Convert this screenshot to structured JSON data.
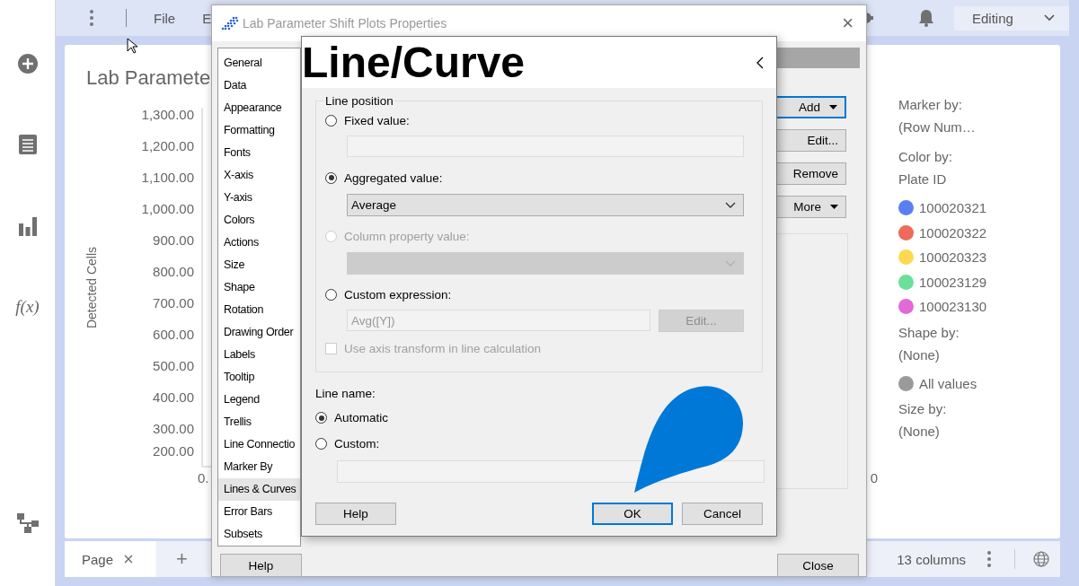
{
  "app": {
    "rail": {
      "function_label": "f(x)"
    },
    "menu": [
      "File",
      "E"
    ],
    "mode_dropdown": "Editing"
  },
  "page": {
    "title": "Lab Paramete",
    "plot": {
      "y_axis_title": "Detected Cells",
      "y_ticks": [
        "1,300.00",
        "1,200.00",
        "1,100.00",
        "1,000.00",
        "900.00",
        "800.00",
        "700.00",
        "600.00",
        "500.00",
        "400.00",
        "300.00",
        "200.00"
      ],
      "x_ticks": [
        "0.",
        "0"
      ]
    },
    "legend": [
      {
        "kind": "heading",
        "text": "Marker by:"
      },
      {
        "kind": "value",
        "text": "(Row Num…"
      },
      {
        "kind": "heading",
        "text": "Color by:"
      },
      {
        "kind": "value",
        "text": "Plate ID"
      },
      {
        "kind": "swatch",
        "text": "100020321",
        "color": "#5b7ff0"
      },
      {
        "kind": "swatch",
        "text": "100020322",
        "color": "#ef6a5a"
      },
      {
        "kind": "swatch",
        "text": "100020323",
        "color": "#fcd94e"
      },
      {
        "kind": "swatch",
        "text": "100023129",
        "color": "#6be09a"
      },
      {
        "kind": "swatch",
        "text": "100023130",
        "color": "#e469d8"
      },
      {
        "kind": "heading",
        "text": "Shape by:"
      },
      {
        "kind": "value",
        "text": "(None)"
      },
      {
        "kind": "swatch",
        "text": "All values",
        "color": "#9a9a9a"
      },
      {
        "kind": "heading",
        "text": "Size by:"
      },
      {
        "kind": "value",
        "text": "(None)"
      }
    ]
  },
  "status_bar": {
    "tabs": [
      {
        "label": "Page",
        "selected": true
      }
    ],
    "add_tab": "+",
    "column_count": "13 columns"
  },
  "properties_dialog": {
    "title": "Lab Parameter Shift Plots Properties",
    "close": "×",
    "categories": [
      {
        "label": "General",
        "selected": false
      },
      {
        "label": "Data",
        "selected": false
      },
      {
        "label": "Appearance",
        "selected": false
      },
      {
        "label": "Formatting",
        "selected": false
      },
      {
        "label": "Fonts",
        "selected": false
      },
      {
        "label": "X-axis",
        "selected": false
      },
      {
        "label": "Y-axis",
        "selected": false
      },
      {
        "label": "Colors",
        "selected": false
      },
      {
        "label": "Actions",
        "selected": false
      },
      {
        "label": "Size",
        "selected": false
      },
      {
        "label": "Shape",
        "selected": false
      },
      {
        "label": "Rotation",
        "selected": false
      },
      {
        "label": "Drawing Order",
        "selected": false
      },
      {
        "label": "Labels",
        "selected": false
      },
      {
        "label": "Tooltip",
        "selected": false
      },
      {
        "label": "Legend",
        "selected": false
      },
      {
        "label": "Trellis",
        "selected": false
      },
      {
        "label": "Line Connectio",
        "selected": false
      },
      {
        "label": "Marker By",
        "selected": false
      },
      {
        "label": "Lines & Curves",
        "selected": true
      },
      {
        "label": "Error Bars",
        "selected": false
      },
      {
        "label": "Subsets",
        "selected": false
      }
    ],
    "line_buttons": [
      {
        "label": "Add",
        "menu": true,
        "focused": true
      },
      {
        "label": "Edit...",
        "menu": false,
        "focused": false
      },
      {
        "label": "Remove",
        "menu": false,
        "focused": false
      },
      {
        "label": "More",
        "menu": true,
        "focused": false
      }
    ],
    "help": "Help",
    "close_button": "Close"
  },
  "line_dialog": {
    "caption": "Line/Curve",
    "position": {
      "title": "Line position",
      "options": [
        {
          "label": "Fixed value:",
          "selected": false,
          "disabled": false,
          "control": {
            "kind": "input",
            "disabled": true
          }
        },
        {
          "label": "Aggregated value:",
          "selected": true,
          "disabled": false,
          "control": {
            "kind": "select",
            "value": "Average",
            "disabled": false
          }
        },
        {
          "label": "Column property value:",
          "selected": false,
          "disabled": true,
          "control": {
            "kind": "select",
            "disabled": true
          }
        },
        {
          "label": "Custom expression:",
          "selected": false,
          "disabled": false,
          "control": {
            "kind": "input_button",
            "value": "Avg([Y])",
            "button": "Edit...",
            "disabled": true
          }
        }
      ],
      "transform": {
        "label": "Use axis transform in line calculation",
        "checked": false,
        "disabled": true
      }
    },
    "name": {
      "title": "Line name:",
      "options": [
        {
          "label": "Automatic",
          "selected": true
        },
        {
          "label": "Custom:",
          "selected": false
        }
      ],
      "input": {
        "disabled": true
      }
    },
    "buttons": [
      {
        "label": "Help",
        "focused": false
      },
      {
        "label": "OK",
        "focused": true
      },
      {
        "label": "Cancel",
        "focused": false
      }
    ]
  }
}
